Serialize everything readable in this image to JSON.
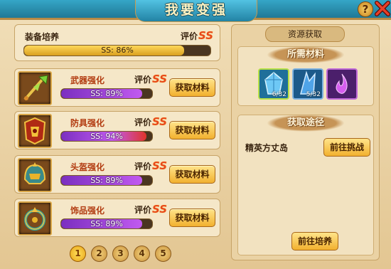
{
  "window": {
    "title": "我要变强",
    "help_label": "?",
    "close_icon": "close-icon"
  },
  "summary": {
    "title": "装备培养",
    "rating_label": "评价",
    "rating": "SS",
    "progress_text": "SS: 86%",
    "progress": 0.86
  },
  "items": [
    {
      "name": "武器强化",
      "icon": "weapon-icon",
      "rating_label": "评价",
      "rating": "SS",
      "progress_text": "SS: 89%",
      "progress": 0.89,
      "button": "获取材料"
    },
    {
      "name": "防具强化",
      "icon": "armor-icon",
      "rating_label": "评价",
      "rating": "SS",
      "progress_text": "SS: 94%",
      "progress": 0.94,
      "button": "获取材料"
    },
    {
      "name": "头盔强化",
      "icon": "helmet-icon",
      "rating_label": "评价",
      "rating": "SS",
      "progress_text": "SS: 89%",
      "progress": 0.89,
      "button": "获取材料"
    },
    {
      "name": "饰品强化",
      "icon": "accessory-icon",
      "rating_label": "评价",
      "rating": "SS",
      "progress_text": "SS: 89%",
      "progress": 0.89,
      "button": "获取材料"
    }
  ],
  "pager": {
    "pages": [
      "1",
      "2",
      "3",
      "4",
      "5"
    ],
    "active": "1"
  },
  "resources": {
    "title": "资源获取",
    "materials_title": "所需材料",
    "materials": [
      {
        "icon": "blue-crystal-icon",
        "count": "6/32"
      },
      {
        "icon": "ice-shard-icon",
        "count": "5/32"
      },
      {
        "icon": "purple-flame-icon",
        "count": ""
      }
    ],
    "routes_title": "获取途径",
    "route_name": "精英方丈岛",
    "route_button": "前往挑战",
    "train_button": "前往培养"
  },
  "colors": {
    "accent": "#f2b12f",
    "title_bar": "#2283a4",
    "rating": "#e8481a",
    "bar_purple": "#a13fe0",
    "bar_red": "#e0342a",
    "bar_gold": "#f0c23a"
  }
}
